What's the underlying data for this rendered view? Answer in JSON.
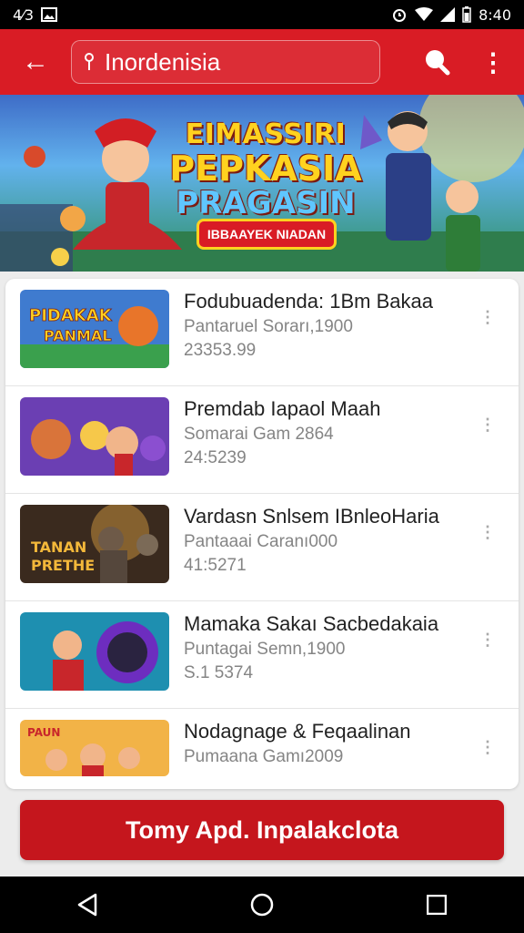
{
  "status_bar": {
    "left_label": "4⁄3",
    "time": "8:40"
  },
  "app_bar": {
    "back_glyph": "←",
    "search_value": "Inordenisia",
    "search_placeholder": "",
    "menu_glyph": "⋮"
  },
  "banner": {
    "title_line1": "EIMASSIRI",
    "title_line2": "PEPKASIA",
    "title_line3": "PRAGASIN",
    "ribbon_text": "IBBAAYEK NIADAN"
  },
  "list": [
    {
      "title": "Fodubuadenda: 1Bm Bakaa",
      "subtitle": "Pantaruel Sorarı,1900",
      "number": "23353.99",
      "thumb_text": "PIDAKAK PANMAL"
    },
    {
      "title": "Premdab Iapaol Maah",
      "subtitle": "Somarai Gam 2864",
      "number": "24:5239",
      "thumb_text": ""
    },
    {
      "title": "Vardasn Snlsem IBnleoHaria",
      "subtitle": "Pantaaai Caranı000",
      "number": "41:5271",
      "thumb_text": "TANAN PRETHE"
    },
    {
      "title": "Mamaka Sakaı Sacbedakaia",
      "subtitle": "Puntagai Semn,1900",
      "number": "S.1 5374",
      "thumb_text": ""
    },
    {
      "title": "Nodagnage & Feqaalinan",
      "subtitle": "Pumaana Gamı2009",
      "number": "",
      "thumb_text": "PAUN"
    }
  ],
  "more_glyph": "⋮",
  "cta_label": "Tomy Apd. Inpalakclota",
  "nav": {
    "back": "back",
    "home": "home",
    "recents": "recents"
  },
  "colors": {
    "primary": "#d91c25",
    "cta": "#c5161d"
  }
}
